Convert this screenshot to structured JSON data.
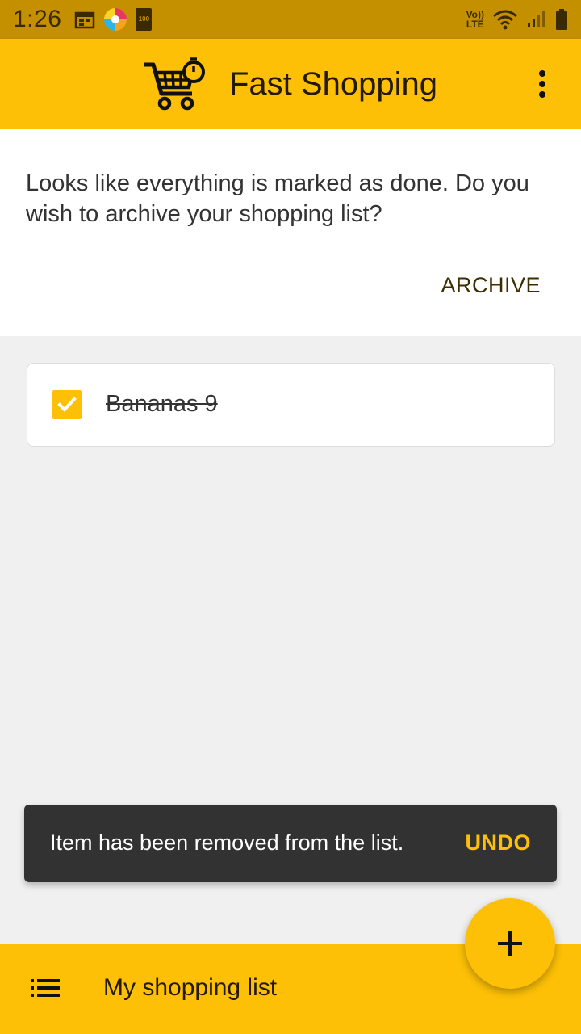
{
  "status_bar": {
    "time": "1:26",
    "battery_small_label": "100",
    "network_label_top": "Vo))",
    "network_label_bottom": "LTE"
  },
  "app_bar": {
    "title": "Fast Shopping",
    "logo_icon": "shopping-cart-timer-icon",
    "menu_icon": "more-vert-icon"
  },
  "banner": {
    "message": "Looks like everything is marked as done. Do you wish to archive your shopping list?",
    "archive_label": "ARCHIVE"
  },
  "list": {
    "items": [
      {
        "label": "Bananas 9",
        "checked": true
      }
    ]
  },
  "snackbar": {
    "message": "Item has been removed from the list.",
    "action_label": "UNDO"
  },
  "bottom_bar": {
    "title": "My shopping list",
    "menu_icon": "list-icon"
  },
  "fab": {
    "icon": "plus-icon"
  },
  "colors": {
    "primary": "#fdc007",
    "status_bar": "#c49000",
    "snackbar": "#323232",
    "accent_text": "#fdc007"
  }
}
